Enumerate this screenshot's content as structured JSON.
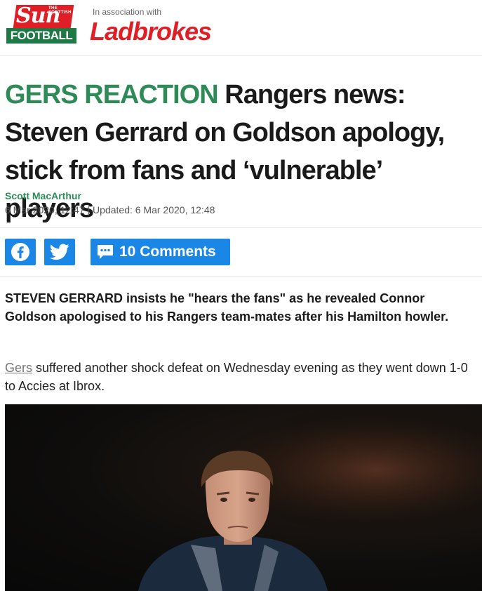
{
  "header": {
    "brand_small": "THE SCOTTISH",
    "brand_sun": "Sun",
    "brand_section": "FOOTBALL",
    "association_label": "In association with",
    "partner": "Ladbrokes"
  },
  "article": {
    "kicker": "GERS REACTION",
    "title": "Rangers news: Steven Gerrard on Goldson apology, stick from fans and ‘vulnerable’ players",
    "author": "Scott MacArthur",
    "dates": "6 Mar 2020, 12:47 | Updated: 6 Mar 2020, 12:48",
    "standfirst_lead": "STEVEN GERRARD",
    "standfirst_rest": " insists he \"hears the fans\" as he revealed Connor Goldson apologised to his Rangers team-mates after his Hamilton howler.",
    "body_link": "Gers",
    "body_rest": " suffered another shock defeat on Wednesday evening as they went down 1-0 to Accies at Ibrox."
  },
  "share": {
    "facebook_icon": "facebook-icon",
    "twitter_icon": "twitter-icon",
    "comments_label": "10 Comments",
    "accent": "#1a87e6"
  },
  "colors": {
    "brand_green": "#2e8b57",
    "sun_red": "#e01e26",
    "football_green": "#1d7a45"
  }
}
